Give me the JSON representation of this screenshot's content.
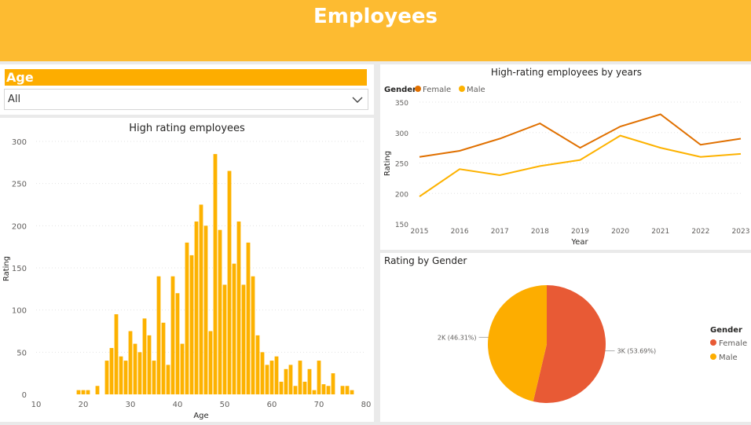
{
  "header": {
    "title": "Employees"
  },
  "slicer": {
    "title": "Age",
    "value": "All"
  },
  "hist": {
    "title": "High rating employees",
    "chart_data": {
      "type": "bar",
      "title": "High rating employees",
      "xlabel": "Age",
      "ylabel": "Rating",
      "xlim": [
        10,
        80
      ],
      "ylim": [
        0,
        300
      ],
      "xticks": [
        10,
        20,
        30,
        40,
        50,
        60,
        70,
        80
      ],
      "yticks": [
        0,
        50,
        100,
        150,
        200,
        250,
        300
      ],
      "color": "#fdb200",
      "x": [
        19,
        20,
        21,
        23,
        25,
        26,
        27,
        28,
        29,
        30,
        31,
        32,
        33,
        34,
        35,
        36,
        37,
        38,
        39,
        40,
        41,
        42,
        43,
        44,
        45,
        46,
        47,
        48,
        49,
        50,
        51,
        52,
        53,
        54,
        55,
        56,
        57,
        58,
        59,
        60,
        61,
        62,
        63,
        64,
        65,
        66,
        67,
        68,
        69,
        70,
        71,
        72,
        73,
        75,
        76,
        77
      ],
      "values": [
        5,
        5,
        5,
        10,
        40,
        55,
        95,
        45,
        40,
        75,
        60,
        50,
        90,
        70,
        40,
        140,
        85,
        35,
        140,
        120,
        60,
        180,
        165,
        205,
        225,
        200,
        75,
        285,
        195,
        130,
        265,
        155,
        205,
        130,
        180,
        140,
        70,
        50,
        35,
        40,
        45,
        15,
        30,
        35,
        10,
        40,
        15,
        30,
        5,
        40,
        12,
        10,
        25,
        10,
        10,
        5
      ]
    }
  },
  "line": {
    "title": "High-rating employees by years",
    "chart_data": {
      "type": "line",
      "title": "High-rating employees by years",
      "xlabel": "Year",
      "ylabel": "Rating",
      "legend_title": "Gender",
      "legend_position": "top-left",
      "x": [
        2015,
        2016,
        2017,
        2018,
        2019,
        2020,
        2021,
        2022,
        2023
      ],
      "ylim": [
        150,
        350
      ],
      "yticks": [
        150,
        200,
        250,
        300,
        350
      ],
      "series": [
        {
          "name": "Female",
          "color": "#e07000",
          "values": [
            260,
            270,
            290,
            315,
            275,
            310,
            330,
            280,
            290
          ]
        },
        {
          "name": "Male",
          "color": "#fdb200",
          "values": [
            195,
            240,
            230,
            245,
            255,
            295,
            275,
            260,
            265
          ]
        }
      ]
    }
  },
  "pie": {
    "title": "Rating by Gender",
    "chart_data": {
      "type": "pie",
      "title": "Rating by Gender",
      "legend_title": "Gender",
      "legend_position": "right",
      "labels": [
        "Female",
        "Male"
      ],
      "values": [
        53.69,
        46.31
      ],
      "data_labels": [
        "3K (53.69%)",
        "2K (46.31%)"
      ],
      "colors": [
        "#e85a35",
        "#fdad00"
      ]
    }
  }
}
